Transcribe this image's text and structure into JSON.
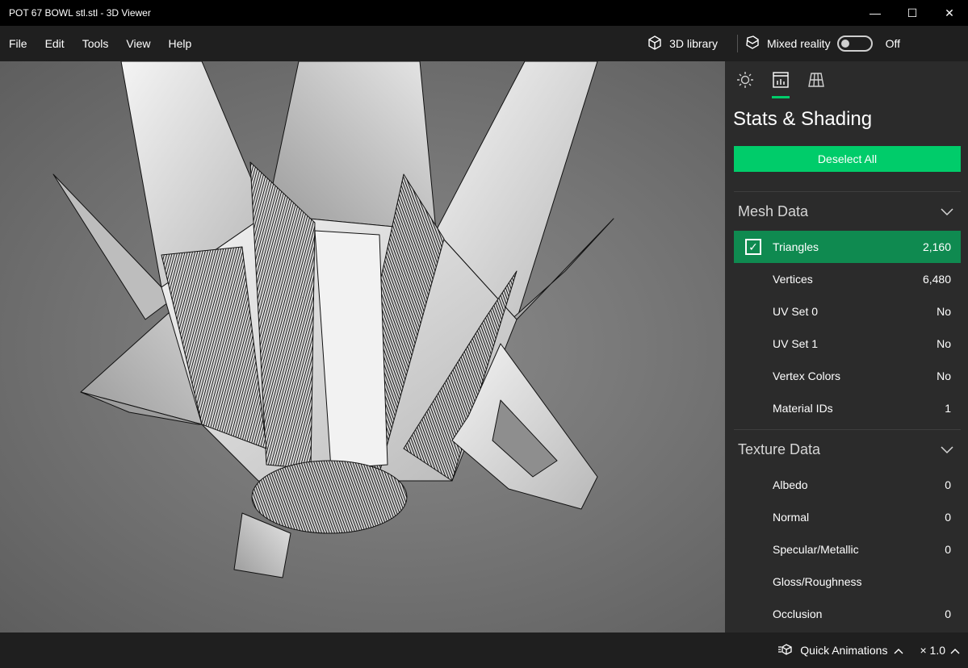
{
  "window": {
    "title": "POT 67 BOWL stl.stl - 3D Viewer",
    "controls": {
      "minimize": "—",
      "maximize": "☐",
      "close": "✕"
    }
  },
  "menu": {
    "items": [
      "File",
      "Edit",
      "Tools",
      "View",
      "Help"
    ],
    "library_label": "3D library",
    "mixed_reality_label": "Mixed reality",
    "mixed_reality_state": "Off"
  },
  "panel": {
    "tabs": [
      {
        "icon": "lighting-icon",
        "active": false
      },
      {
        "icon": "stats-icon",
        "active": true
      },
      {
        "icon": "grid-icon",
        "active": false
      }
    ],
    "title": "Stats & Shading",
    "deselect_label": "Deselect All",
    "mesh_section": {
      "title": "Mesh Data",
      "rows": [
        {
          "label": "Triangles",
          "value": "2,160",
          "checked": true
        },
        {
          "label": "Vertices",
          "value": "6,480"
        },
        {
          "label": "UV Set 0",
          "value": "No"
        },
        {
          "label": "UV Set 1",
          "value": "No"
        },
        {
          "label": "Vertex Colors",
          "value": "No"
        },
        {
          "label": "Material IDs",
          "value": "1"
        }
      ]
    },
    "texture_section": {
      "title": "Texture Data",
      "rows": [
        {
          "label": "Albedo",
          "value": "0"
        },
        {
          "label": "Normal",
          "value": "0"
        },
        {
          "label": "Specular/Metallic",
          "value": "0"
        },
        {
          "label": "Gloss/Roughness",
          "value": ""
        },
        {
          "label": "Occlusion",
          "value": "0"
        }
      ]
    }
  },
  "bottom": {
    "quick_animations_label": "Quick Animations",
    "speed_label": "× 1.0"
  },
  "colors": {
    "accent": "#00cc6a",
    "selected_row": "#0f8a50",
    "panel_bg": "#2b2b2b",
    "titlebar_bg": "#000000"
  }
}
